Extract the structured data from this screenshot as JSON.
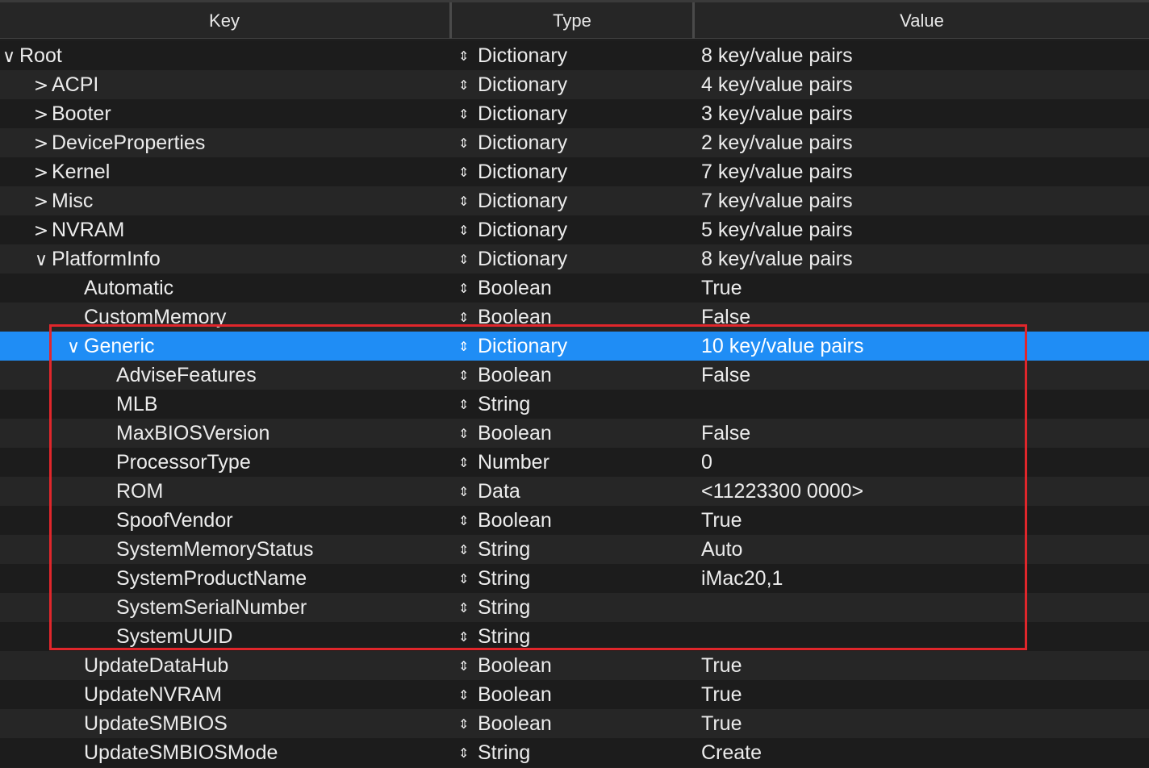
{
  "columns": {
    "key": "Key",
    "type": "Type",
    "value": "Value"
  },
  "icons": {
    "expanded": "chevron-down-icon",
    "collapsed": "chevron-right-icon",
    "type_stepper": "up-down-arrow-icon"
  },
  "colors": {
    "selection": "#1f8df5",
    "highlight_border": "#e0262b"
  },
  "rows": [
    {
      "key": "Root",
      "type": "Dictionary",
      "value": "8 key/value pairs",
      "level": 0,
      "disclosure": "expanded"
    },
    {
      "key": "ACPI",
      "type": "Dictionary",
      "value": "4 key/value pairs",
      "level": 1,
      "disclosure": "collapsed"
    },
    {
      "key": "Booter",
      "type": "Dictionary",
      "value": "3 key/value pairs",
      "level": 1,
      "disclosure": "collapsed"
    },
    {
      "key": "DeviceProperties",
      "type": "Dictionary",
      "value": "2 key/value pairs",
      "level": 1,
      "disclosure": "collapsed"
    },
    {
      "key": "Kernel",
      "type": "Dictionary",
      "value": "7 key/value pairs",
      "level": 1,
      "disclosure": "collapsed"
    },
    {
      "key": "Misc",
      "type": "Dictionary",
      "value": "7 key/value pairs",
      "level": 1,
      "disclosure": "collapsed"
    },
    {
      "key": "NVRAM",
      "type": "Dictionary",
      "value": "5 key/value pairs",
      "level": 1,
      "disclosure": "collapsed"
    },
    {
      "key": "PlatformInfo",
      "type": "Dictionary",
      "value": "8 key/value pairs",
      "level": 1,
      "disclosure": "expanded"
    },
    {
      "key": "Automatic",
      "type": "Boolean",
      "value": "True",
      "level": 2,
      "disclosure": "none"
    },
    {
      "key": "CustomMemory",
      "type": "Boolean",
      "value": "False",
      "level": 2,
      "disclosure": "none"
    },
    {
      "key": "Generic",
      "type": "Dictionary",
      "value": "10 key/value pairs",
      "level": 2,
      "disclosure": "expanded",
      "selected": true
    },
    {
      "key": "AdviseFeatures",
      "type": "Boolean",
      "value": "False",
      "level": 3,
      "disclosure": "none"
    },
    {
      "key": "MLB",
      "type": "String",
      "value": "",
      "level": 3,
      "disclosure": "none"
    },
    {
      "key": "MaxBIOSVersion",
      "type": "Boolean",
      "value": "False",
      "level": 3,
      "disclosure": "none"
    },
    {
      "key": "ProcessorType",
      "type": "Number",
      "value": "0",
      "level": 3,
      "disclosure": "none"
    },
    {
      "key": "ROM",
      "type": "Data",
      "value": "<11223300 0000>",
      "level": 3,
      "disclosure": "none"
    },
    {
      "key": "SpoofVendor",
      "type": "Boolean",
      "value": "True",
      "level": 3,
      "disclosure": "none"
    },
    {
      "key": "SystemMemoryStatus",
      "type": "String",
      "value": "Auto",
      "level": 3,
      "disclosure": "none"
    },
    {
      "key": "SystemProductName",
      "type": "String",
      "value": "iMac20,1",
      "level": 3,
      "disclosure": "none"
    },
    {
      "key": "SystemSerialNumber",
      "type": "String",
      "value": "",
      "level": 3,
      "disclosure": "none"
    },
    {
      "key": "SystemUUID",
      "type": "String",
      "value": "",
      "level": 3,
      "disclosure": "none"
    },
    {
      "key": "UpdateDataHub",
      "type": "Boolean",
      "value": "True",
      "level": 2,
      "disclosure": "none"
    },
    {
      "key": "UpdateNVRAM",
      "type": "Boolean",
      "value": "True",
      "level": 2,
      "disclosure": "none"
    },
    {
      "key": "UpdateSMBIOS",
      "type": "Boolean",
      "value": "True",
      "level": 2,
      "disclosure": "none"
    },
    {
      "key": "UpdateSMBIOSMode",
      "type": "String",
      "value": "Create",
      "level": 2,
      "disclosure": "none"
    }
  ]
}
